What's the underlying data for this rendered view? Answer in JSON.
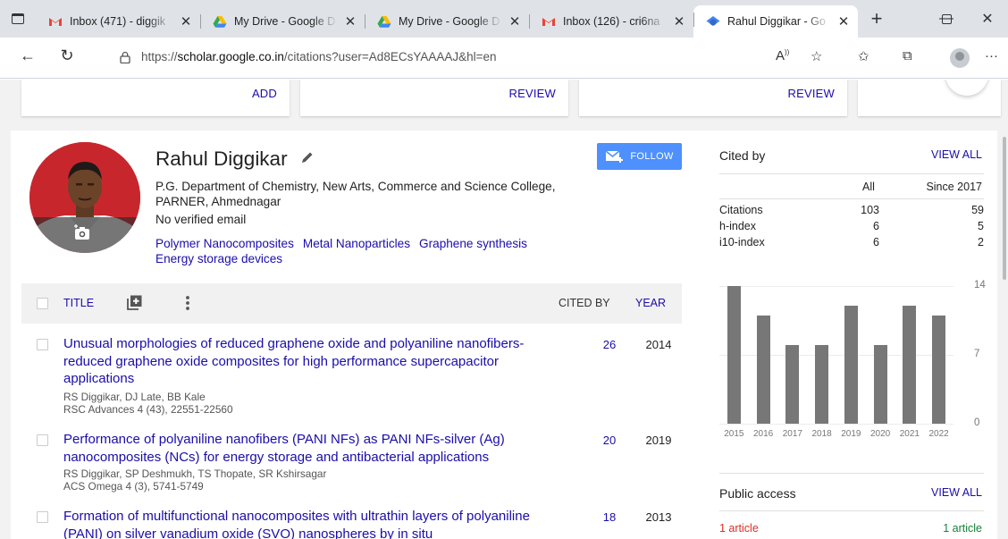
{
  "browser": {
    "tabs": [
      {
        "icon": "gmail-icon",
        "title": "Inbox (471) - diggik",
        "active": false
      },
      {
        "icon": "google-drive-icon",
        "title": "My Drive - Google D",
        "active": false
      },
      {
        "icon": "google-drive-icon",
        "title": "My Drive - Google D",
        "active": false
      },
      {
        "icon": "gmail-icon",
        "title": "Inbox (126) - cri6na",
        "active": false
      },
      {
        "icon": "scholar-icon",
        "title": "Rahul Diggikar - Go",
        "active": true
      }
    ],
    "new_tab_label": "+",
    "url_prefix": "https://",
    "url_host": "scholar.google.co.in",
    "url_path": "/citations?user=Ad8ECsYAAAAJ&hl=en"
  },
  "top_cards": {
    "card1": "ADD",
    "card2": "REVIEW",
    "card3": "REVIEW"
  },
  "profile": {
    "name": "Rahul Diggikar",
    "affiliation": "P.G. Department of Chemistry, New Arts, Commerce and Science College, PARNER, Ahmednagar",
    "email": "No verified email",
    "interests": [
      "Polymer Nanocomposites",
      "Metal Nanoparticles",
      "Graphene synthesis",
      "Energy storage devices"
    ],
    "follow_label": "FOLLOW"
  },
  "table": {
    "title_col": "TITLE",
    "cited_col": "CITED BY",
    "year_col": "YEAR"
  },
  "articles": [
    {
      "title": "Unusual morphologies of reduced graphene oxide and polyaniline nanofibers-reduced graphene oxide composites for high performance supercapacitor applications",
      "authors": "RS Diggikar, DJ Late, BB Kale",
      "venue": "RSC Advances 4 (43), 22551-22560",
      "cited_by": "26",
      "year": "2014"
    },
    {
      "title": "Performance of polyaniline nanofibers (PANI NFs) as PANI NFs-silver (Ag) nanocomposites (NCs) for energy storage and antibacterial applications",
      "authors": "RS Diggikar, SP Deshmukh, TS Thopate, SR Kshirsagar",
      "venue": "ACS Omega 4 (3), 5741-5749",
      "cited_by": "20",
      "year": "2019"
    },
    {
      "title": "Formation of multifunctional nanocomposites with ultrathin layers of polyaniline (PANI) on silver vanadium oxide (SVO) nanospheres by in situ",
      "authors": "",
      "venue": "",
      "cited_by": "18",
      "year": "2013"
    }
  ],
  "cited_by": {
    "title": "Cited by",
    "view_all": "VIEW ALL",
    "col_all": "All",
    "col_since": "Since 2017",
    "rows": [
      {
        "label": "Citations",
        "all": "103",
        "since": "59"
      },
      {
        "label": "h-index",
        "all": "6",
        "since": "5"
      },
      {
        "label": "i10-index",
        "all": "6",
        "since": "2"
      }
    ]
  },
  "chart_data": {
    "type": "bar",
    "categories": [
      "2015",
      "2016",
      "2017",
      "2018",
      "2019",
      "2020",
      "2021",
      "2022"
    ],
    "values": [
      14,
      11,
      8,
      8,
      12,
      8,
      12,
      11
    ],
    "ylim": [
      0,
      14
    ],
    "yticks": [
      "14",
      "7",
      "0"
    ],
    "bar_color": "#777777"
  },
  "public_access": {
    "title": "Public access",
    "view_all": "VIEW ALL",
    "not_available": "1 article",
    "available": "1 article"
  },
  "colors": {
    "link": "#1a0dab",
    "follow": "#4d90fe",
    "available": "#188038",
    "not_available": "#d93025"
  }
}
